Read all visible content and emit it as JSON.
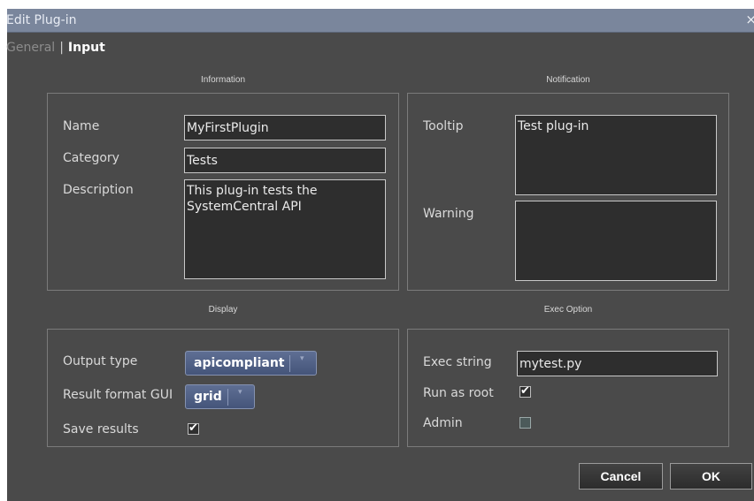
{
  "window": {
    "title": "Edit Plug-in",
    "close_label": "×"
  },
  "tabs": {
    "general": "General",
    "separator": "|",
    "input": "Input",
    "active": "Input"
  },
  "information": {
    "title": "Information",
    "name_label": "Name",
    "name_value": "MyFirstPlugin",
    "category_label": "Category",
    "category_value": "Tests",
    "description_label": "Description",
    "description_value": "This plug-in tests the\nSystemCentral API"
  },
  "notification": {
    "title": "Notification",
    "tooltip_label": "Tooltip",
    "tooltip_value": "Test plug-in",
    "warning_label": "Warning",
    "warning_value": ""
  },
  "display": {
    "title": "Display",
    "output_type_label": "Output type",
    "output_type_value": "apicompliant",
    "result_format_label": "Result format GUI",
    "result_format_value": "grid",
    "save_results_label": "Save results",
    "save_results_checked": true
  },
  "exec_option": {
    "title": "Exec Option",
    "exec_string_label": "Exec string",
    "exec_string_value": "mytest.py",
    "run_as_root_label": "Run as root",
    "run_as_root_checked": true,
    "admin_label": "Admin",
    "admin_checked": false
  },
  "buttons": {
    "cancel": "Cancel",
    "ok": "OK"
  },
  "icons": {
    "checkmark": "✔",
    "dropdown_arrow": "▾"
  },
  "colors": {
    "background": "#4a4a4a",
    "titlebar": "#7a869c",
    "dropdown": "#52628a"
  }
}
